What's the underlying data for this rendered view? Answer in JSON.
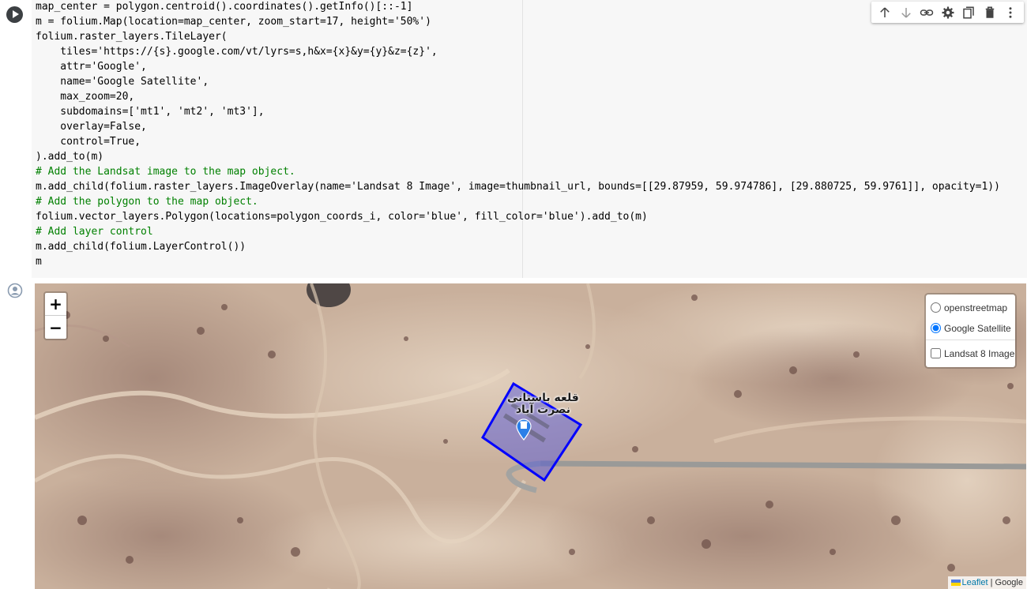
{
  "toolbar": {
    "buttons": [
      "move-up",
      "move-down",
      "link",
      "settings",
      "mirror-cell",
      "delete",
      "more"
    ]
  },
  "code": {
    "line1": "map_center = polygon.centroid().coordinates().getInfo()[::-1]",
    "line2": "m = folium.Map(location=map_center, zoom_start=17, height='50%')",
    "line3": "folium.raster_layers.TileLayer(",
    "line4": "    tiles='https://{s}.google.com/vt/lyrs=s,h&x={x}&y={y}&z={z}',",
    "line5": "    attr='Google',",
    "line6": "    name='Google Satellite',",
    "line7": "    max_zoom=20,",
    "line8": "    subdomains=['mt1', 'mt2', 'mt3'],",
    "line9": "    overlay=False,",
    "line10": "    control=True,",
    "line11": ").add_to(m)",
    "line12": "# Add the Landsat image to the map object.",
    "line13": "m.add_child(folium.raster_layers.ImageOverlay(name='Landsat 8 Image', image=thumbnail_url, bounds=[[29.87959, 59.974786], [29.880725, 59.9761]], opacity=1))",
    "line14": "# Add the polygon to the map object.",
    "line15": "folium.vector_layers.Polygon(locations=polygon_coords_i, color='blue', fill_color='blue').add_to(m)",
    "line16": "# Add layer control",
    "line17": "m.add_child(folium.LayerControl())",
    "line18": "m"
  },
  "map": {
    "zoom_in": "+",
    "zoom_out": "−",
    "layers": {
      "base": [
        {
          "label": "openstreetmap",
          "checked": false
        },
        {
          "label": "Google Satellite",
          "checked": true
        }
      ],
      "overlays": [
        {
          "label": "Landsat 8 Image",
          "checked": false
        }
      ]
    },
    "place_label_line1": "قلعه باستانی",
    "place_label_line2": "نصرت آباد",
    "attribution_leaflet": "Leaflet",
    "attribution_sep": " | ",
    "attribution_google": "Google",
    "polygon_color": "#0000ff"
  }
}
